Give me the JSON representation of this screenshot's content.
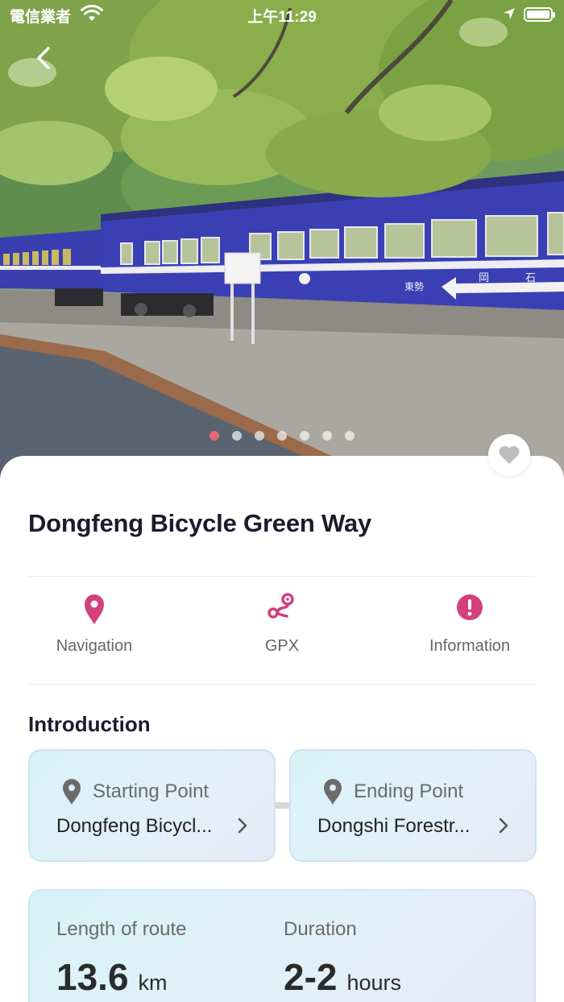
{
  "status_bar": {
    "carrier": "電信業者",
    "time": "上午11:29"
  },
  "hero": {
    "dot_count": 7,
    "active_dot": 0,
    "sign_text": "石岡 ⟵ 東勢"
  },
  "route": {
    "title": "Dongfeng Bicycle Green Way"
  },
  "actions": [
    {
      "label": "Navigation",
      "icon": "map-pin-icon"
    },
    {
      "label": "GPX",
      "icon": "route-icon"
    },
    {
      "label": "Information",
      "icon": "info-alert-icon"
    }
  ],
  "introduction": {
    "heading": "Introduction",
    "start": {
      "label": "Starting Point",
      "value": "Dongfeng Bicycl..."
    },
    "end": {
      "label": "Ending Point",
      "value": "Dongshi Forestr..."
    }
  },
  "stats": {
    "length": {
      "label": "Length of route",
      "value": "13.6",
      "unit": "km"
    },
    "duration": {
      "label": "Duration",
      "value": "2-2",
      "unit": "hours"
    }
  },
  "colors": {
    "accent": "#d43f7e",
    "active_dot": "#e36a73",
    "title_text": "#1e1a2e",
    "train_blue": "#3a3fb0"
  }
}
